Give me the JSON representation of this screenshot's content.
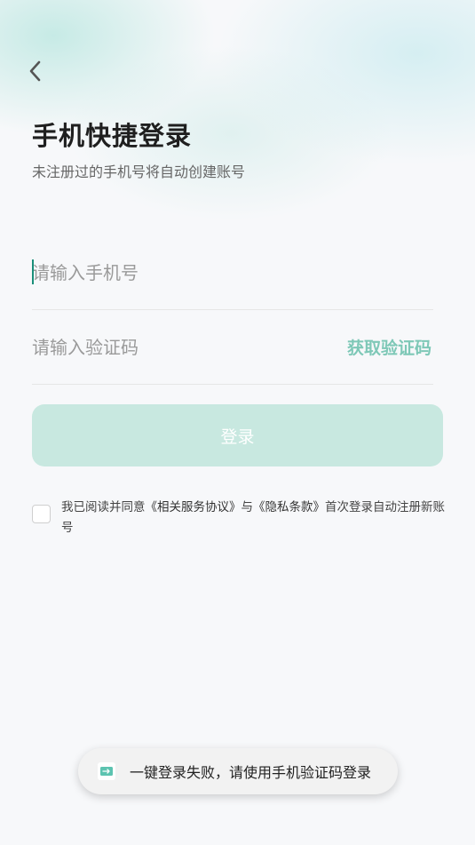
{
  "header": {
    "title": "手机快捷登录",
    "subtitle": "未注册过的手机号将自动创建账号"
  },
  "form": {
    "phone_placeholder": "请输入手机号",
    "phone_value": "",
    "code_placeholder": "请输入验证码",
    "code_value": "",
    "get_code_label": "获取验证码",
    "login_label": "登录"
  },
  "agreement": {
    "checked": false,
    "prefix": "我已阅读并同意",
    "service_link": "《相关服务协议》",
    "and": "与",
    "privacy_link": "《隐私条款》",
    "suffix": "首次登录自动注册新账号"
  },
  "toast": {
    "icon": "app-icon",
    "message": "一键登录失败，请使用手机验证码登录"
  },
  "colors": {
    "accent": "#1a8f7a",
    "get_code_text": "#7ec8b7",
    "login_button_bg": "#c8e8e0",
    "background": "#f7f8fa"
  }
}
